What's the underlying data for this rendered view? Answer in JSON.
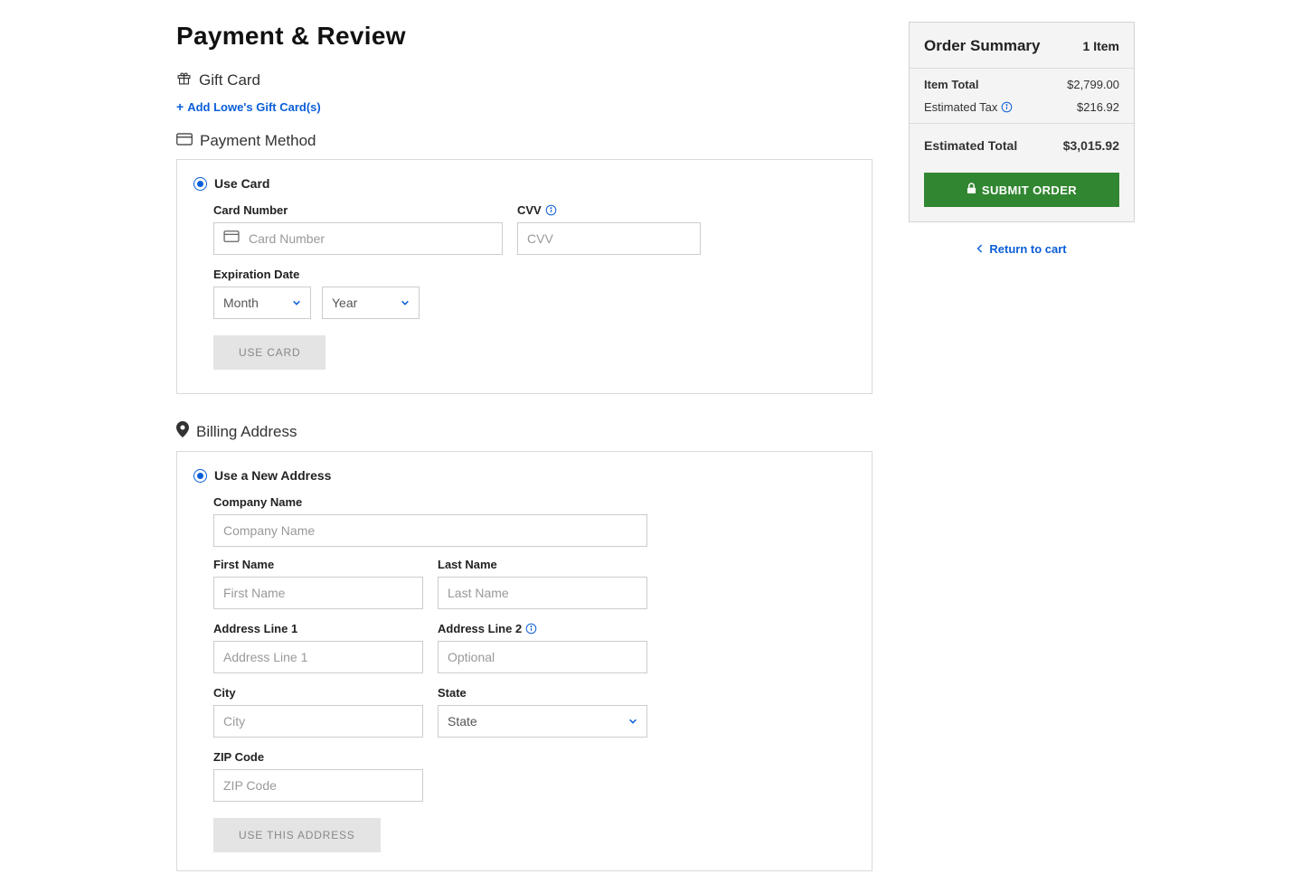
{
  "page": {
    "title": "Payment & Review"
  },
  "giftCard": {
    "heading": "Gift Card",
    "addLink": "Add Lowe's Gift Card(s)"
  },
  "paymentMethod": {
    "heading": "Payment Method",
    "useCardLabel": "Use Card",
    "cardNumberLabel": "Card Number",
    "cardNumberPlaceholder": "Card Number",
    "cvvLabel": "CVV",
    "cvvPlaceholder": "CVV",
    "expirationLabel": "Expiration Date",
    "monthPlaceholder": "Month",
    "yearPlaceholder": "Year",
    "useCardButton": "USE CARD"
  },
  "billing": {
    "heading": "Billing Address",
    "useNewLabel": "Use a New Address",
    "companyLabel": "Company Name",
    "companyPlaceholder": "Company Name",
    "firstNameLabel": "First Name",
    "firstNamePlaceholder": "First Name",
    "lastNameLabel": "Last Name",
    "lastNamePlaceholder": "Last Name",
    "address1Label": "Address Line 1",
    "address1Placeholder": "Address Line 1",
    "address2Label": "Address Line 2",
    "address2Placeholder": "Optional",
    "cityLabel": "City",
    "cityPlaceholder": "City",
    "stateLabel": "State",
    "statePlaceholder": "State",
    "zipLabel": "ZIP Code",
    "zipPlaceholder": "ZIP Code",
    "useAddressButton": "USE THIS ADDRESS"
  },
  "summary": {
    "heading": "Order Summary",
    "itemCount": "1 Item",
    "itemTotalLabel": "Item Total",
    "itemTotalValue": "$2,799.00",
    "taxLabel": "Estimated Tax",
    "taxValue": "$216.92",
    "estTotalLabel": "Estimated Total",
    "estTotalValue": "$3,015.92",
    "submitButton": "SUBMIT ORDER",
    "returnLink": "Return to cart"
  }
}
